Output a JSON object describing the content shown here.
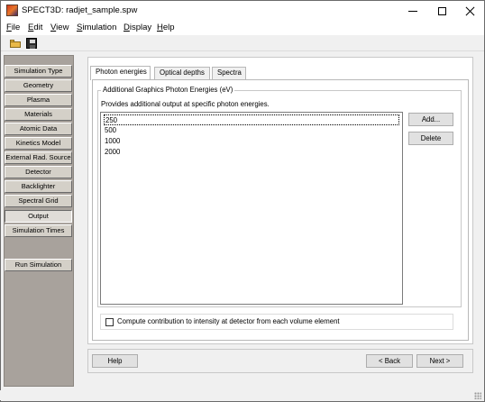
{
  "window": {
    "title": "SPECT3D:  radjet_sample.spw",
    "menu": [
      "File",
      "Edit",
      "View",
      "Simulation",
      "Display",
      "Help"
    ]
  },
  "toolbar": {
    "open_icon": "folder-open-icon",
    "save_icon": "floppy-disk-icon"
  },
  "sidebar": {
    "items": [
      {
        "label": "Simulation Type",
        "active": false
      },
      {
        "label": "Geometry",
        "active": false
      },
      {
        "label": "Plasma",
        "active": false
      },
      {
        "label": "Materials",
        "active": false
      },
      {
        "label": "Atomic Data",
        "active": false
      },
      {
        "label": "Kinetics Model",
        "active": false
      },
      {
        "label": "External Rad. Source",
        "active": false
      },
      {
        "label": "Detector",
        "active": false
      },
      {
        "label": "Backlighter",
        "active": false
      },
      {
        "label": "Spectral Grid",
        "active": false
      },
      {
        "label": "Output",
        "active": true
      },
      {
        "label": "Simulation Times",
        "active": false
      }
    ],
    "run_label": "Run Simulation"
  },
  "tabs": [
    {
      "label": "Photon energies",
      "active": true
    },
    {
      "label": "Optical depths",
      "active": false
    },
    {
      "label": "Spectra",
      "active": false
    }
  ],
  "photon_panel": {
    "group_title": "Additional Graphics Photon Energies (eV)",
    "description": "Provides additional output at specific photon energies.",
    "energies": [
      "250",
      "500",
      "1000",
      "2000"
    ],
    "add_label": "Add...",
    "delete_label": "Delete",
    "checkbox_label": "Compute contribution to intensity at detector from each volume element",
    "checkbox_checked": false
  },
  "bottom": {
    "help_label": "Help",
    "back_label": "< Back",
    "next_label": "Next >"
  }
}
